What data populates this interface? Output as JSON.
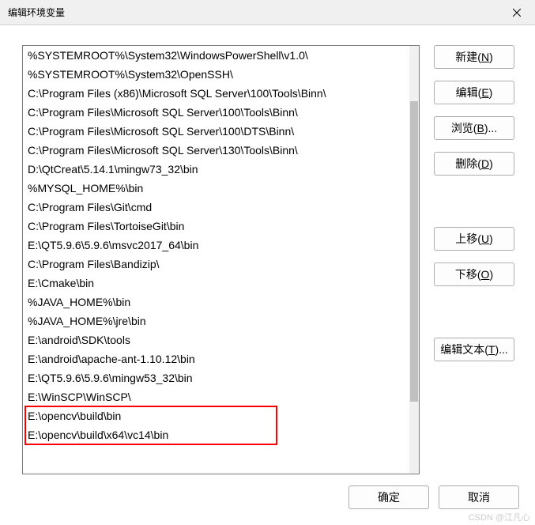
{
  "title": "编辑环境变量",
  "items": [
    "%SYSTEMROOT%\\System32\\WindowsPowerShell\\v1.0\\",
    "%SYSTEMROOT%\\System32\\OpenSSH\\",
    "C:\\Program Files (x86)\\Microsoft SQL Server\\100\\Tools\\Binn\\",
    "C:\\Program Files\\Microsoft SQL Server\\100\\Tools\\Binn\\",
    "C:\\Program Files\\Microsoft SQL Server\\100\\DTS\\Binn\\",
    "C:\\Program Files\\Microsoft SQL Server\\130\\Tools\\Binn\\",
    "D:\\QtCreat\\5.14.1\\mingw73_32\\bin",
    "%MYSQL_HOME%\\bin",
    "C:\\Program Files\\Git\\cmd",
    "C:\\Program Files\\TortoiseGit\\bin",
    "E:\\QT5.9.6\\5.9.6\\msvc2017_64\\bin",
    "C:\\Program Files\\Bandizip\\",
    "E:\\Cmake\\bin",
    "%JAVA_HOME%\\bin",
    "%JAVA_HOME%\\jre\\bin",
    "E:\\android\\SDK\\tools",
    "E:\\android\\apache-ant-1.10.12\\bin",
    "E:\\QT5.9.6\\5.9.6\\mingw53_32\\bin",
    "E:\\WinSCP\\WinSCP\\",
    "E:\\opencv\\build\\bin",
    "E:\\opencv\\build\\x64\\vc14\\bin"
  ],
  "buttons": {
    "new": "新建(N)",
    "edit": "编辑(E)",
    "browse": "浏览(B)...",
    "delete": "删除(D)",
    "moveUp": "上移(U)",
    "moveDown": "下移(O)",
    "editText": "编辑文本(T)...",
    "ok": "确定",
    "cancel": "取消"
  },
  "highlight": {
    "startIndex": 19,
    "endIndex": 20
  },
  "watermark": "CSDN @江凡心"
}
